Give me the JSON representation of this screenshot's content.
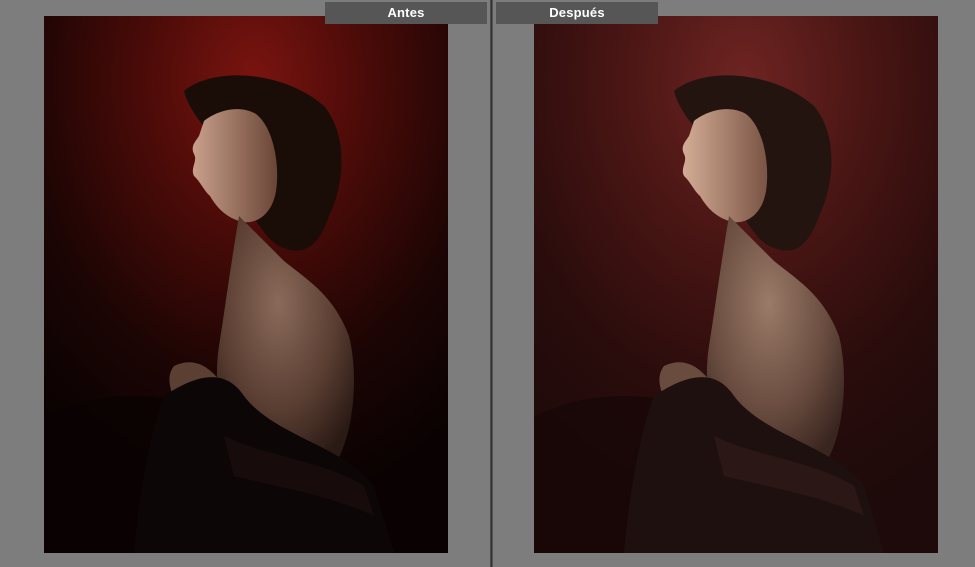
{
  "compare": {
    "before_label": "Antes",
    "after_label": "Después"
  },
  "colors": {
    "background": "#808080",
    "label_bar": "#565656",
    "label_text": "#ffffff",
    "backdrop_red_before": "#7a1410",
    "backdrop_red_after": "#6e2422"
  },
  "images": {
    "before": "portrait-before-edit",
    "after": "portrait-after-edit"
  }
}
